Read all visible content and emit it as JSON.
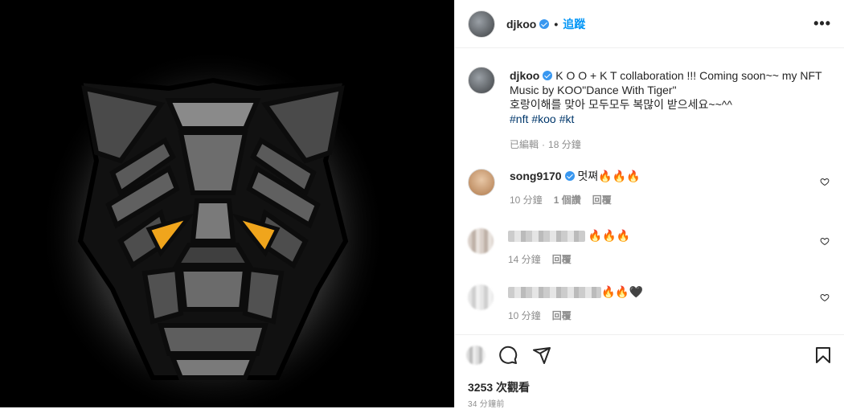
{
  "post": {
    "username": "djkoo",
    "follow_label": "追蹤",
    "dot": "•",
    "more": "•••"
  },
  "caption": {
    "username": "djkoo",
    "text_line1": "K O O + K T collaboration !!! Coming soon~~ my NFT",
    "text_line2": "Music by KOO\"Dance With Tiger\"",
    "text_line3": "호랑이해를 맞아 모두모두 복많이 받으세요~~^^",
    "tags": [
      "#nft",
      "#koo",
      "#kt"
    ],
    "meta_edited": "已編輯",
    "meta_sep": "·",
    "meta_time": "18 分鐘"
  },
  "comments": [
    {
      "username": "song9170",
      "text": "멋쪄🔥🔥🔥",
      "time": "10 分鐘",
      "likes": "1 個讚",
      "reply": "回覆"
    },
    {
      "username": "",
      "text": "🔥🔥🔥",
      "time": "14 分鐘",
      "reply": "回覆"
    },
    {
      "username": "",
      "text": "🔥🔥🖤",
      "time": "10 分鐘",
      "reply": "回覆"
    }
  ],
  "footer": {
    "views": "3253 次觀看",
    "time": "34 分鐘前"
  },
  "icons": [
    "heart-icon",
    "comment-icon",
    "share-icon",
    "bookmark-icon",
    "verified-icon",
    "more-icon"
  ],
  "colors": {
    "link": "#0095f6",
    "tag": "#00376b",
    "verified": "#3897f0",
    "muted": "#8e8e8e"
  }
}
